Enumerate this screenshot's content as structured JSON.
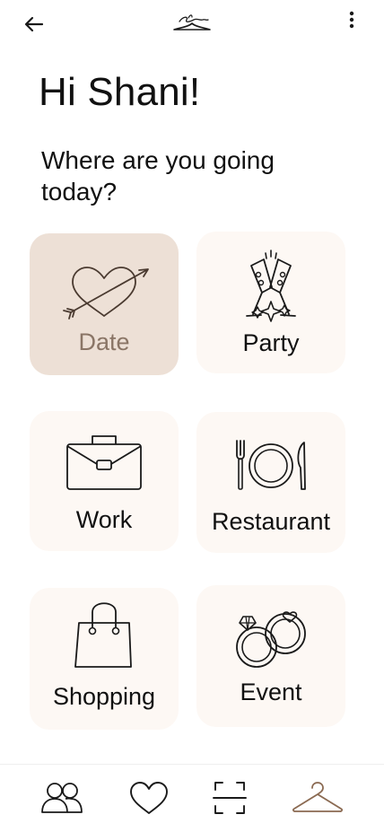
{
  "header": {
    "back_icon": "arrow-left-icon",
    "logo_icon": "hanger-logo-icon",
    "menu_icon": "more-vertical-icon"
  },
  "greeting": "Hi Shani!",
  "question": "Where are you going today?",
  "occasions": [
    {
      "label": "Date",
      "icon": "heart-arrow-icon",
      "selected": true
    },
    {
      "label": "Party",
      "icon": "champagne-toast-icon",
      "selected": false
    },
    {
      "label": "Work",
      "icon": "briefcase-icon",
      "selected": false
    },
    {
      "label": "Restaurant",
      "icon": "fork-plate-knife-icon",
      "selected": false
    },
    {
      "label": "Shopping",
      "icon": "shopping-bag-icon",
      "selected": false
    },
    {
      "label": "Event",
      "icon": "wedding-rings-icon",
      "selected": false
    }
  ],
  "bottom_nav": [
    {
      "icon": "people-icon",
      "active": false
    },
    {
      "icon": "heart-icon",
      "active": false
    },
    {
      "icon": "scan-icon",
      "active": false
    },
    {
      "icon": "hanger-icon",
      "active": true
    }
  ],
  "colors": {
    "tile_background": "#fdf8f4",
    "tile_selected_background": "#ede0d6",
    "selected_label": "#8a7566",
    "accent_brown": "#8b6a52",
    "icon_dark": "#1a1a1a"
  }
}
